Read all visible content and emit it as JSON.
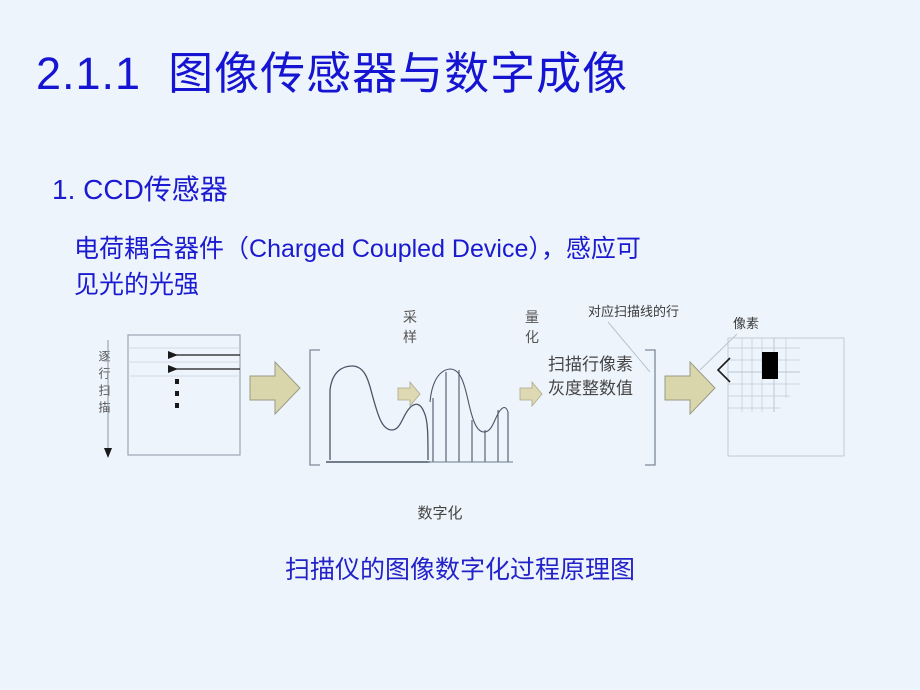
{
  "slide": {
    "background_color": "#eef4fb",
    "title": "2.1.1  图像传感器与数字成像",
    "title_color": "#1414d2",
    "level1_bullet": "1. CCD传感器",
    "body_cjk_1": "电荷耦合器件（",
    "body_latin": "Charged Coupled   Device",
    "body_cjk_2": "），感应可",
    "body_line2": "见光的光强",
    "body_color": "#1a1ad0"
  },
  "figure": {
    "caption": "扫描仪的图像数字化过程原理图",
    "caption_color": "#2222c8",
    "digitize_label": "数字化",
    "scan_label_vertical": "逐行扫描",
    "stage_labels": {
      "sampling": "采样",
      "quantization": "量化"
    },
    "value_label_line1": "扫描行像素",
    "value_label_line2": "灰度整数值",
    "annotation_row": "对应扫描线的行",
    "annotation_pixel": "像素",
    "arrow_fill": "#d9d6ab",
    "arrow_stroke": "#9a9a86",
    "line_color": "#6b7a8f",
    "faint_line_color": "#c8d2de",
    "pixel_color": "#000000"
  }
}
